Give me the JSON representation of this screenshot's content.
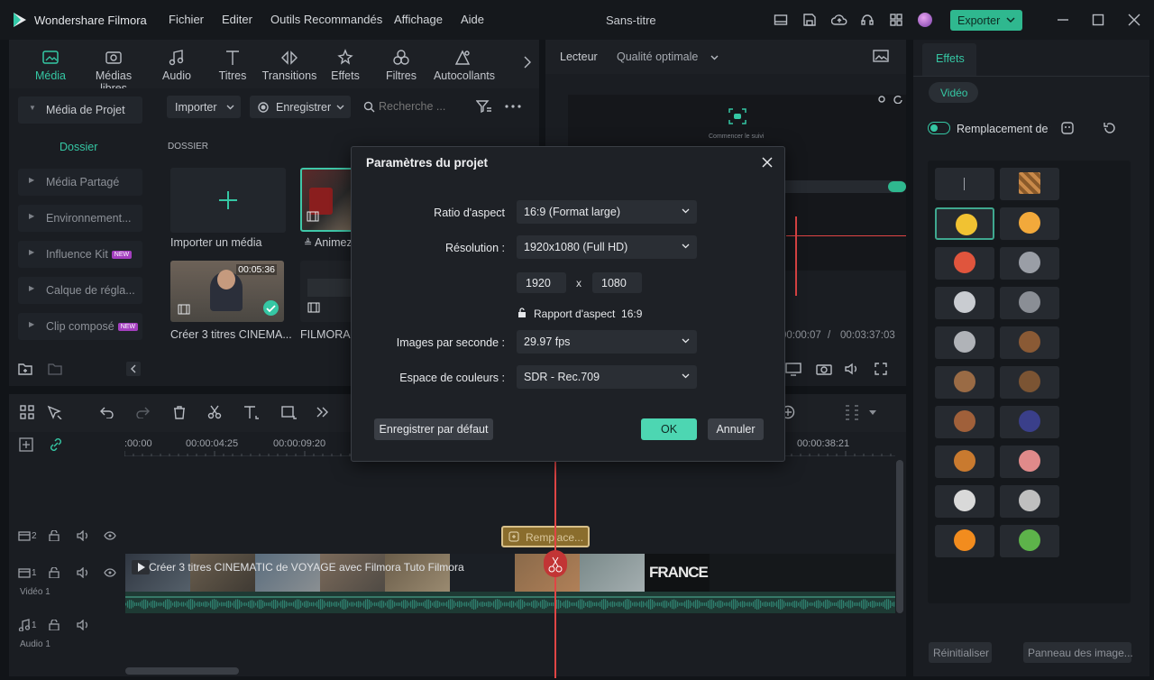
{
  "app": {
    "name": "Wondershare Filmora",
    "project_title": "Sans-titre"
  },
  "menu": [
    "Fichier",
    "Editer",
    "Outils Recommandés",
    "Affichage",
    "Aide"
  ],
  "export_label": "Exporter",
  "tool_tabs": [
    {
      "label": "Média",
      "icon": "media-icon",
      "active": true
    },
    {
      "label": "Médias libres",
      "icon": "stock-media-icon"
    },
    {
      "label": "Audio",
      "icon": "audio-note-icon"
    },
    {
      "label": "Titres",
      "icon": "titles-icon"
    },
    {
      "label": "Transitions",
      "icon": "transitions-icon"
    },
    {
      "label": "Effets",
      "icon": "effects-icon"
    },
    {
      "label": "Filtres",
      "icon": "filters-icon"
    },
    {
      "label": "Autocollants",
      "icon": "stickers-icon"
    }
  ],
  "sidebar": {
    "items": [
      {
        "label": "Média de Projet"
      },
      {
        "label": "Dossier"
      },
      {
        "label": "Média Partagé"
      },
      {
        "label": "Environnement..."
      },
      {
        "label": "Influence Kit",
        "badge": "NEW"
      },
      {
        "label": "Calque de régla..."
      },
      {
        "label": "Clip composé",
        "badge": "NEW"
      }
    ]
  },
  "media_toolbar": {
    "import": "Importer",
    "record": "Enregistrer",
    "search_placeholder": "Recherche ..."
  },
  "media": {
    "folder_label": "DOSSIER",
    "import_tile": "Importer un média",
    "items": [
      {
        "name": "Animez",
        "duration": ""
      },
      {
        "name": "Créer 3 titres CINEMA...",
        "duration": "00:05:36"
      },
      {
        "name": "FILMORA",
        "duration": ""
      }
    ]
  },
  "player": {
    "tab": "Lecteur",
    "quality": "Qualité optimale",
    "time_current": "00:00:07",
    "time_total": "00:03:37:03",
    "hint": "Commencer le suivi"
  },
  "dialog": {
    "title": "Paramètres du projet",
    "aspect_label": "Ratio d'aspect",
    "aspect_value": "16:9 (Format large)",
    "resolution_label": "Résolution :",
    "resolution_value": "1920x1080 (Full HD)",
    "width": "1920",
    "height": "1080",
    "x_sep": "x",
    "ratio_text": "Rapport d'aspect",
    "ratio_value": "16:9",
    "fps_label": "Images par seconde :",
    "fps_value": "29.97 fps",
    "color_label": "Espace de couleurs :",
    "color_value": "SDR - Rec.709",
    "save_default": "Enregistrer par défaut",
    "ok": "OK",
    "cancel": "Annuler"
  },
  "timeline": {
    "ruler": [
      ":00:00",
      "00:00:04:25",
      "00:00:09:20",
      "00:00:38:21"
    ],
    "tracks": [
      {
        "num": "2",
        "label": ""
      },
      {
        "num": "1",
        "label": "Vidéo 1"
      },
      {
        "num": "1",
        "label": "Audio 1"
      }
    ],
    "effect_clip": "Remplace...",
    "video_clip_title": "Créer 3 titres CINEMATIC de VOYAGE avec Filmora  Tuto Filmora",
    "france_text": "FRANCE"
  },
  "effects_panel": {
    "tab": "Effets",
    "chip": "Vidéo",
    "toggle_label": "Remplacement de v",
    "reset": "Réinitialiser",
    "image_panel": "Panneau des image...",
    "colors": [
      "#e9c33a",
      "#f1c232",
      "#f2a93b",
      "#e0553d",
      "#9a9ea6",
      "#c9ccd1",
      "#8a8e95",
      "#b0b3b8",
      "#8a5a35",
      "#9a6b45",
      "#7b5433",
      "#a0603a",
      "#3a3f8a",
      "#c97a2f",
      "#e08a8a",
      "#d9d9d9",
      "#bfbfbf",
      "#f28c1e",
      "#5db34a"
    ]
  }
}
